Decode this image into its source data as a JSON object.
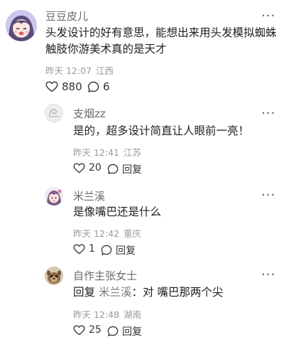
{
  "comments": [
    {
      "username": "豆豆皮儿",
      "avatar_icon": "anime-girl-avatar",
      "text_lines": [
        "头发设计的好有意思，能想出来用头发模拟蜘蛛",
        "触肢你游美术真的是天才"
      ],
      "time": "昨天 12:07",
      "location": "江西",
      "likes": "880",
      "replies": "6",
      "more_glyph": "···"
    }
  ],
  "replies": [
    {
      "username": "支烟zz",
      "avatar_icon": "gray-swirl-avatar",
      "text": "是的，超多设计简直让人眼前一亮！",
      "time": "昨天 12:41",
      "location": "江苏",
      "likes": "20",
      "reply_label": "回复",
      "more_glyph": "···"
    },
    {
      "username": "米兰溪",
      "avatar_icon": "anime-character-avatar",
      "text": "是像嘴巴还是什么",
      "time": "昨天 12:42",
      "location": "重庆",
      "likes": "1",
      "reply_label": "回复",
      "more_glyph": "···"
    },
    {
      "username": "自作主张女士",
      "avatar_icon": "pet-photo-avatar",
      "reply_prefix": "回复",
      "mention": "米兰溪",
      "separator": "：",
      "text": "对 嘴巴那两个尖",
      "time": "昨天 12:48",
      "location": "湖南",
      "likes": "25",
      "reply_label": "回复",
      "more_glyph": "···"
    }
  ]
}
